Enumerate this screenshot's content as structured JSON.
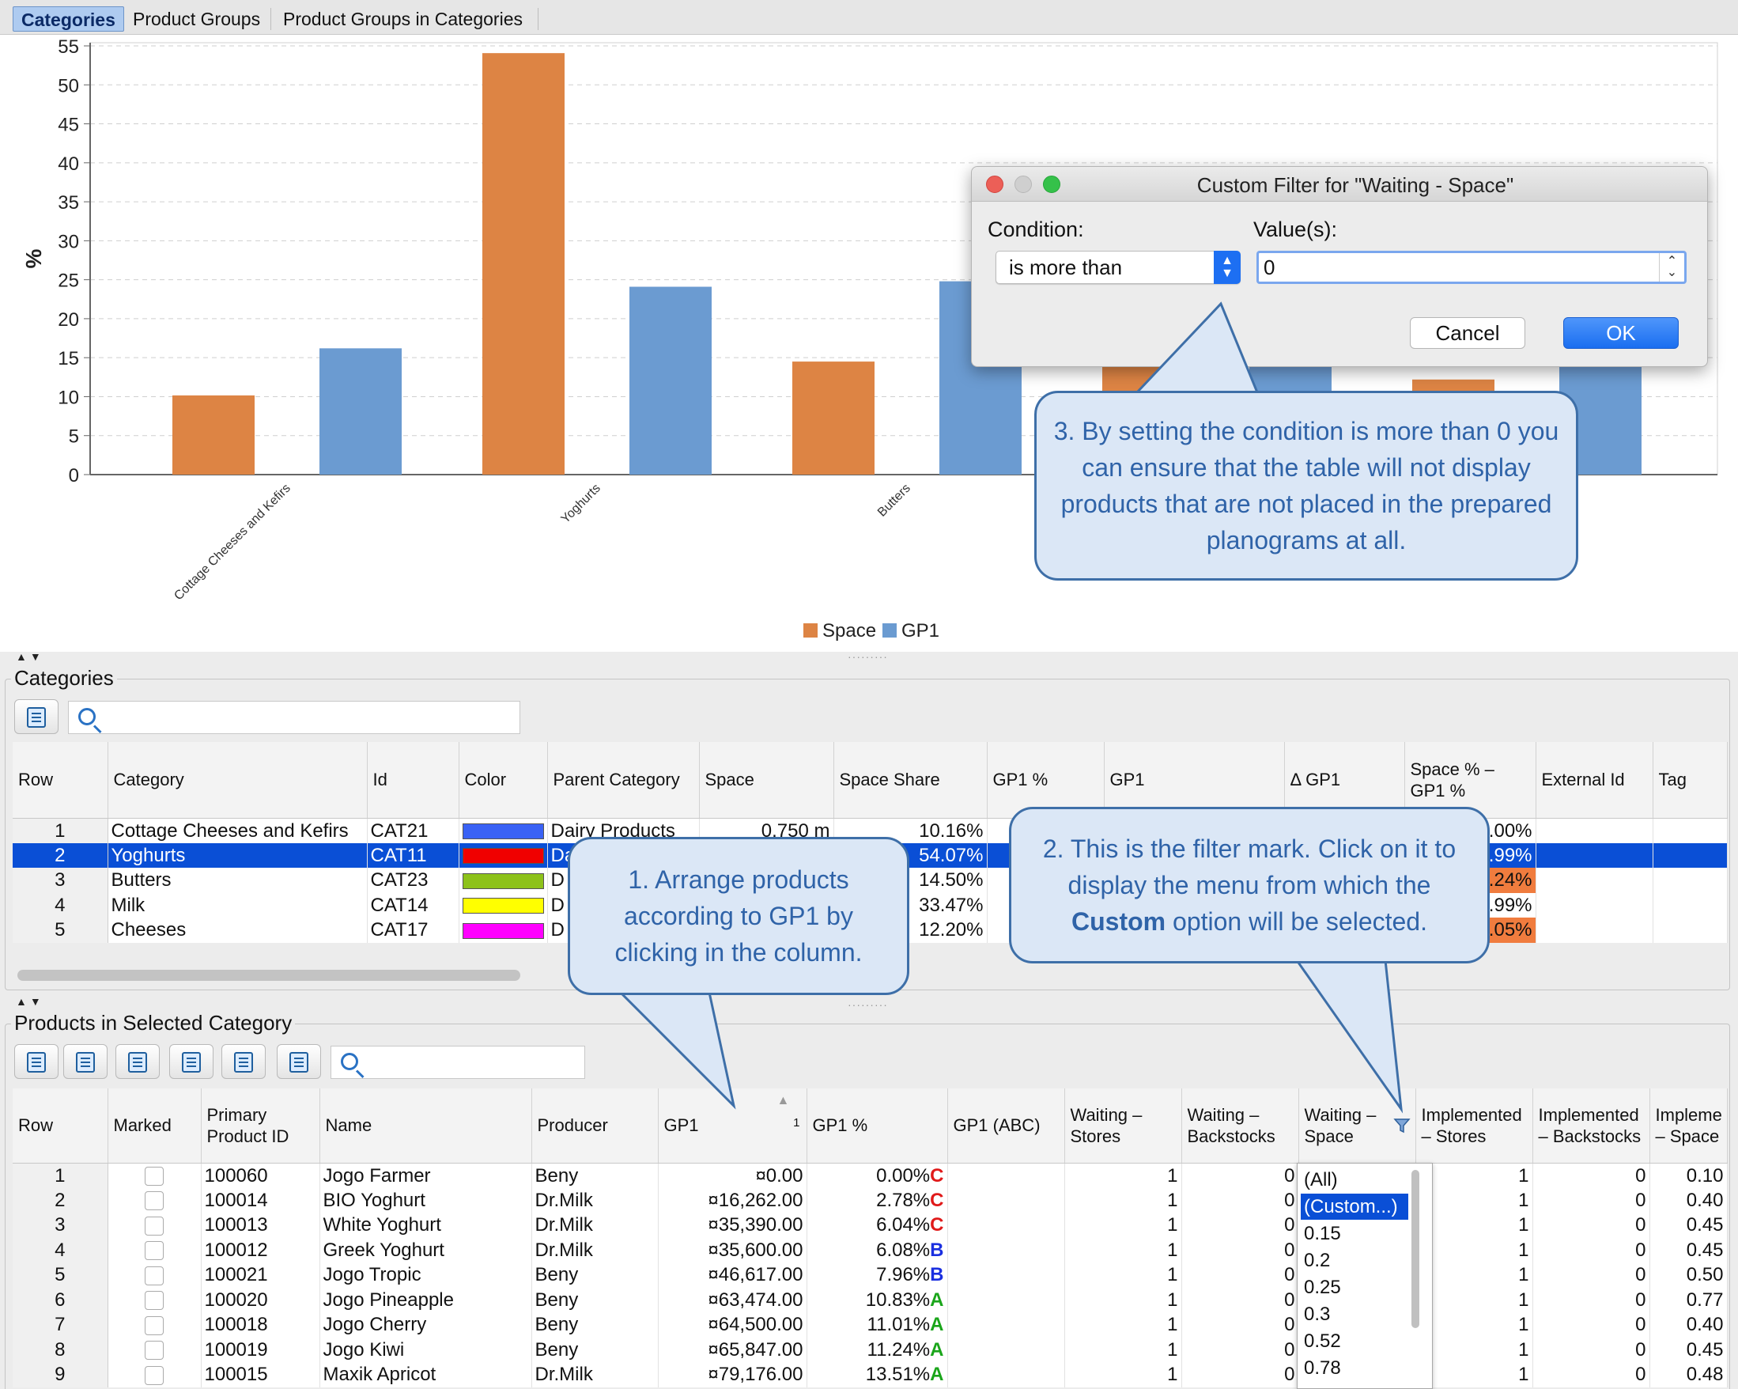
{
  "tabs": [
    {
      "label": "Categories",
      "active": true
    },
    {
      "label": "Product Groups",
      "active": false
    },
    {
      "label": "Product Groups in Categories",
      "active": false
    }
  ],
  "chart_data": {
    "type": "bar",
    "categories": [
      "Cottage Cheeses and Kefirs",
      "Yoghurts",
      "Butters",
      "Milk",
      "Cheeses"
    ],
    "series": [
      {
        "name": "Space",
        "values": [
          10.16,
          54.07,
          14.5,
          33.47,
          12.2
        ],
        "color": "#dd8444"
      },
      {
        "name": "GP1",
        "values": [
          16.2,
          24.1,
          24.8,
          14.5,
          20.3
        ],
        "color": "#6b9bd1"
      }
    ],
    "ylabel": "%",
    "ylim": [
      0,
      55
    ],
    "yticks": [
      0,
      5,
      10,
      15,
      20,
      25,
      30,
      35,
      40,
      45,
      50,
      55
    ],
    "grid": true,
    "legend": "bottom-center"
  },
  "categories_panel": {
    "title": "Categories",
    "search_placeholder": "",
    "columns": [
      "Row",
      "Category",
      "Id",
      "Color",
      "Parent Category",
      "Space",
      "Space Share",
      "GP1 %",
      "GP1",
      "Δ GP1",
      "Space % – GP1 %",
      "External Id",
      "Tag"
    ],
    "rows": [
      {
        "row": "1",
        "category": "Cottage Cheeses and Kefirs",
        "id": "CAT21",
        "color": "#3a62f5",
        "parent": "Dairy Products",
        "space": "0.750 m",
        "share": "10.16%",
        "diff": ".00%",
        "diff_hl": false,
        "selected": false
      },
      {
        "row": "2",
        "category": "Yoghurts",
        "id": "CAT11",
        "color": "#f00000",
        "parent": "Da",
        "space": "",
        "share": "54.07%",
        "diff": ".99%",
        "diff_hl": false,
        "selected": true
      },
      {
        "row": "3",
        "category": "Butters",
        "id": "CAT23",
        "color": "#8dc21a",
        "parent": "D",
        "space": "",
        "share": "14.50%",
        "diff": ".24%",
        "diff_hl": true,
        "selected": false
      },
      {
        "row": "4",
        "category": "Milk",
        "id": "CAT14",
        "color": "#ffff00",
        "parent": "D",
        "space": "",
        "share": "33.47%",
        "diff": ".99%",
        "diff_hl": false,
        "selected": false
      },
      {
        "row": "5",
        "category": "Cheeses",
        "id": "CAT17",
        "color": "#ff00ff",
        "parent": "D",
        "space": "",
        "share": "12.20%",
        "diff": ".05%",
        "diff_hl": true,
        "selected": false
      }
    ]
  },
  "products_panel": {
    "title": "Products in Selected Category",
    "search_placeholder": "",
    "sort_indicator": "1",
    "columns": [
      "Row",
      "Marked",
      "Primary Product ID",
      "Name",
      "Producer",
      "GP1",
      "GP1 %",
      "GP1 (ABC)",
      "Waiting – Stores",
      "Waiting – Backstocks",
      "Waiting – Space",
      "Implemented – Stores",
      "Implemented – Backstocks",
      "Impleme – Space"
    ],
    "rows": [
      {
        "row": "1",
        "pid": "100060",
        "name": "Jogo Farmer",
        "producer": "Beny",
        "gp1": "¤0.00",
        "gp1pct": "0.00%",
        "abc": "C",
        "ws": "1",
        "wb": "0",
        "is": "1",
        "ib": "0",
        "isp": "0.10"
      },
      {
        "row": "2",
        "pid": "100014",
        "name": "BIO Yoghurt",
        "producer": "Dr.Milk",
        "gp1": "¤16,262.00",
        "gp1pct": "2.78%",
        "abc": "C",
        "ws": "1",
        "wb": "0",
        "is": "1",
        "ib": "0",
        "isp": "0.40"
      },
      {
        "row": "3",
        "pid": "100013",
        "name": "White Yoghurt",
        "producer": "Dr.Milk",
        "gp1": "¤35,390.00",
        "gp1pct": "6.04%",
        "abc": "C",
        "ws": "1",
        "wb": "0",
        "is": "1",
        "ib": "0",
        "isp": "0.45"
      },
      {
        "row": "4",
        "pid": "100012",
        "name": "Greek Yoghurt",
        "producer": "Dr.Milk",
        "gp1": "¤35,600.00",
        "gp1pct": "6.08%",
        "abc": "B",
        "ws": "1",
        "wb": "0",
        "is": "1",
        "ib": "0",
        "isp": "0.45"
      },
      {
        "row": "5",
        "pid": "100021",
        "name": "Jogo Tropic",
        "producer": "Beny",
        "gp1": "¤46,617.00",
        "gp1pct": "7.96%",
        "abc": "B",
        "ws": "1",
        "wb": "0",
        "is": "1",
        "ib": "0",
        "isp": "0.50"
      },
      {
        "row": "6",
        "pid": "100020",
        "name": "Jogo Pineapple",
        "producer": "Beny",
        "gp1": "¤63,474.00",
        "gp1pct": "10.83%",
        "abc": "A",
        "ws": "1",
        "wb": "0",
        "is": "1",
        "ib": "0",
        "isp": "0.77"
      },
      {
        "row": "7",
        "pid": "100018",
        "name": "Jogo Cherry",
        "producer": "Beny",
        "gp1": "¤64,500.00",
        "gp1pct": "11.01%",
        "abc": "A",
        "ws": "1",
        "wb": "0",
        "is": "1",
        "ib": "0",
        "isp": "0.40"
      },
      {
        "row": "8",
        "pid": "100019",
        "name": "Jogo Kiwi",
        "producer": "Beny",
        "gp1": "¤65,847.00",
        "gp1pct": "11.24%",
        "abc": "A",
        "ws": "1",
        "wb": "0",
        "is": "1",
        "ib": "0",
        "isp": "0.45"
      },
      {
        "row": "9",
        "pid": "100015",
        "name": "Maxik Apricot",
        "producer": "Dr.Milk",
        "gp1": "¤79,176.00",
        "gp1pct": "13.51%",
        "abc": "A",
        "ws": "1",
        "wb": "0",
        "is": "1",
        "ib": "0",
        "isp": "0.48"
      }
    ],
    "filter_options": [
      "(All)",
      "(Custom...)",
      "0.15",
      "0.2",
      "0.25",
      "0.3",
      "0.52",
      "0.78"
    ],
    "filter_selected": 1
  },
  "dialog": {
    "title": "Custom Filter for \"Waiting - Space\"",
    "condition_label": "Condition:",
    "condition_value": "is more than",
    "values_label": "Value(s):",
    "value": "0",
    "cancel_label": "Cancel",
    "ok_label": "OK"
  },
  "callouts": {
    "one": "1. Arrange products according to GP1 by clicking in the column.",
    "two_pre": "2. This is the filter mark. Click on it to display the menu from which the",
    "two_bold": "Custom",
    "two_post": "option will be selected.",
    "three": "3. By setting the condition is more than 0 you can ensure that the table will not display products that are not placed in the prepared planograms at all."
  }
}
